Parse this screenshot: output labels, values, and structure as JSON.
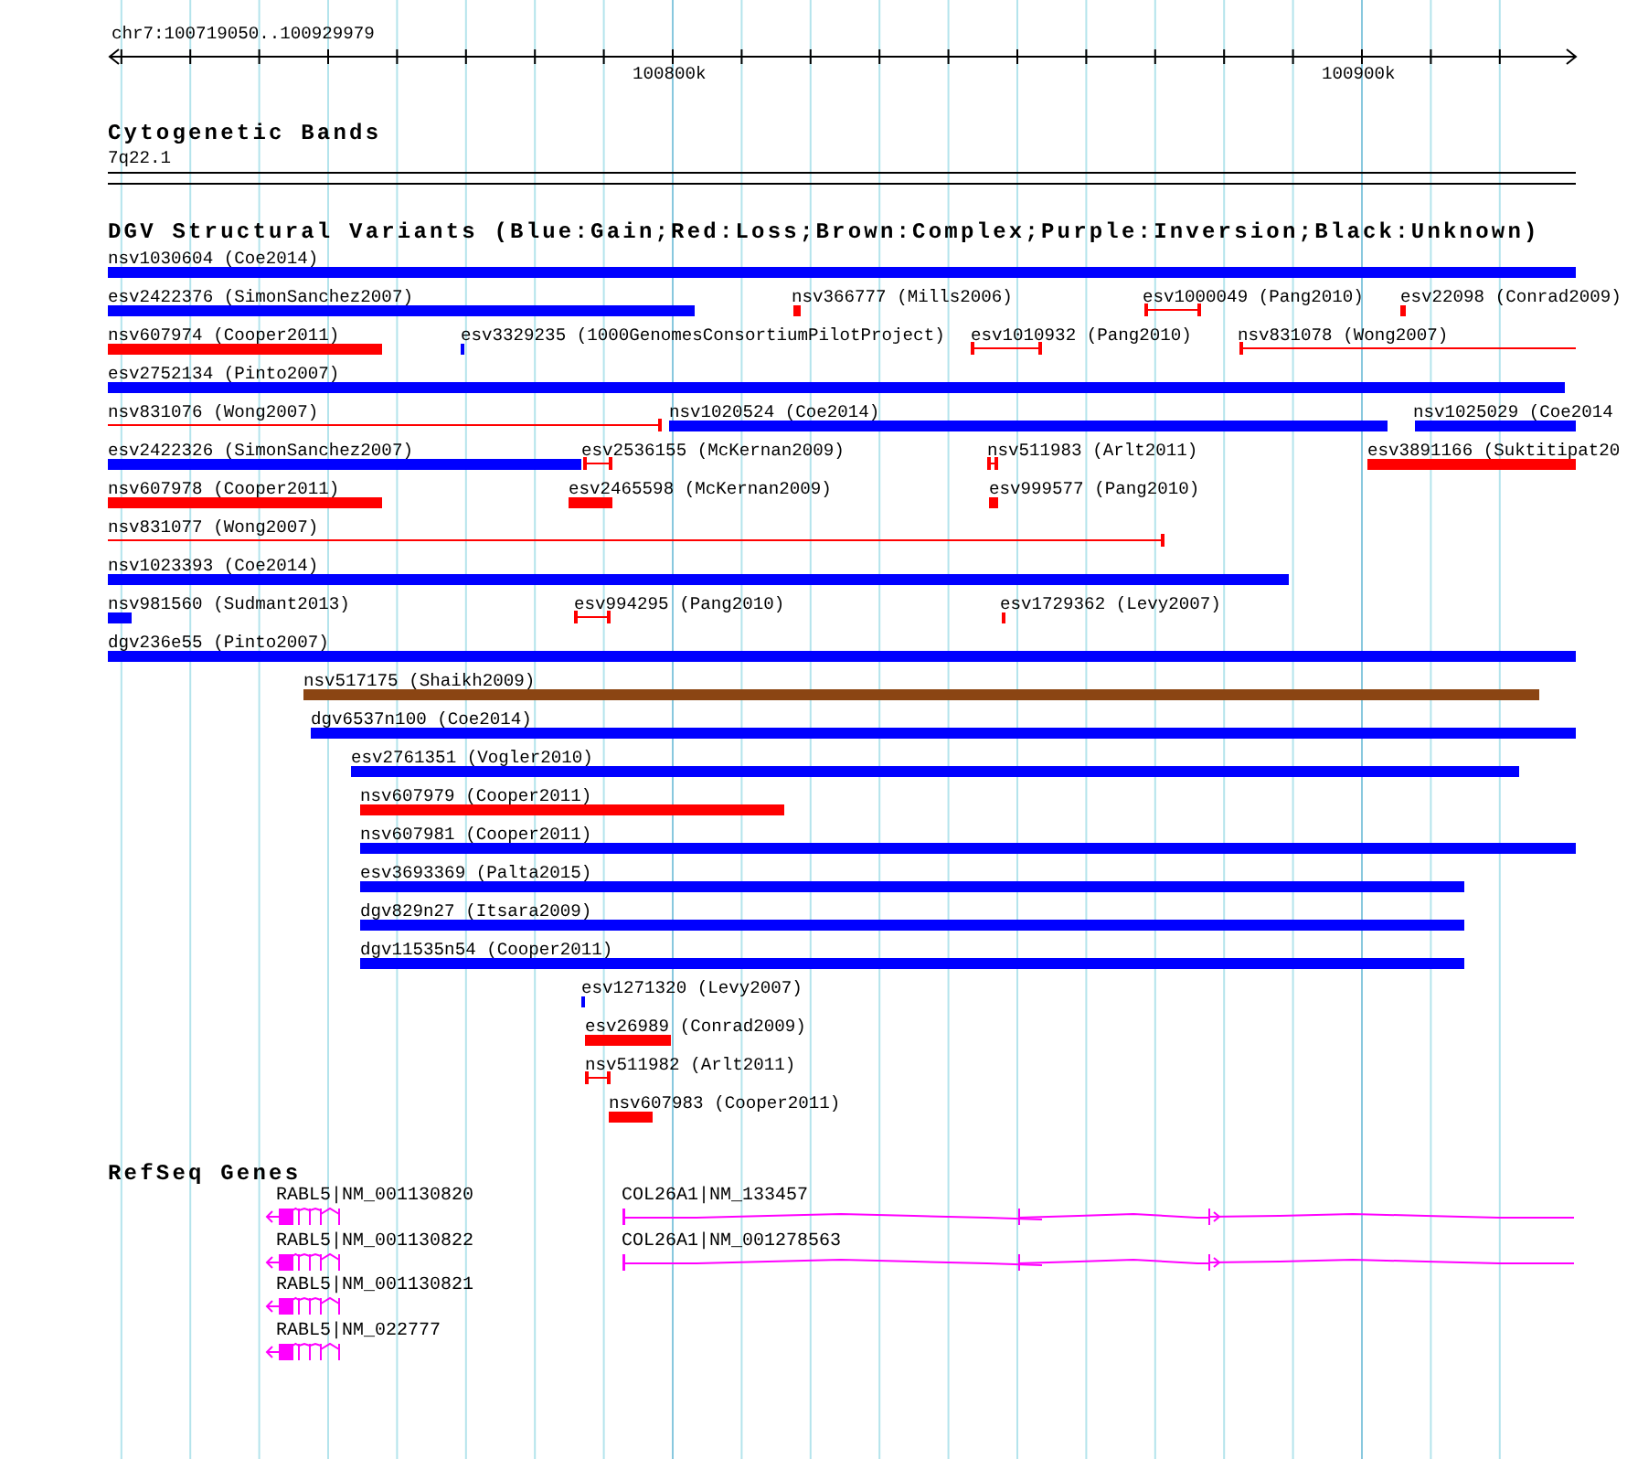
{
  "ruler": {
    "range": "chr7:100719050..100929979",
    "ticks": [
      {
        "label": "100800k"
      },
      {
        "label": "100900k"
      }
    ]
  },
  "cytogenetic_bands": {
    "title": "Cytogenetic Bands",
    "band": "7q22.1"
  },
  "variants": {
    "title": "DGV Structural Variants (Blue:Gain;Red:Loss;Brown:Complex;Purple:Inversion;Black:Unknown)",
    "features": [
      {
        "label": "nsv1030604 (Coe2014)",
        "kind": "bar",
        "color": "#0000ff"
      },
      {
        "label": "esv2422376 (SimonSanchez2007)",
        "kind": "bar",
        "color": "#0000ff"
      },
      {
        "label": "nsv366777 (Mills2006)",
        "kind": "bar",
        "color": "#ff0000"
      },
      {
        "label": "esv1000049 (Pang2010)",
        "kind": "span",
        "color": "#ff0000"
      },
      {
        "label": "esv22098 (Conrad2009)",
        "kind": "bar",
        "color": "#ff0000"
      },
      {
        "label": "nsv607974 (Cooper2011)",
        "kind": "bar",
        "color": "#ff0000"
      },
      {
        "label": "esv3329235 (1000GenomesConsortiumPilotProject)",
        "kind": "bar",
        "color": "#0000ff"
      },
      {
        "label": "esv1010932 (Pang2010)",
        "kind": "span",
        "color": "#ff0000"
      },
      {
        "label": "nsv831078 (Wong2007)",
        "kind": "span",
        "color": "#ff0000"
      },
      {
        "label": "esv2752134 (Pinto2007)",
        "kind": "bar",
        "color": "#0000ff"
      },
      {
        "label": "nsv831076 (Wong2007)",
        "kind": "span",
        "color": "#ff0000"
      },
      {
        "label": "nsv1020524 (Coe2014)",
        "kind": "bar",
        "color": "#0000ff"
      },
      {
        "label": "nsv1025029 (Coe2014",
        "kind": "bar",
        "color": "#0000ff"
      },
      {
        "label": "esv2422326 (SimonSanchez2007)",
        "kind": "bar",
        "color": "#0000ff"
      },
      {
        "label": "esv2536155 (McKernan2009)",
        "kind": "span",
        "color": "#ff0000"
      },
      {
        "label": "nsv511983 (Arlt2011)",
        "kind": "span",
        "color": "#ff0000"
      },
      {
        "label": "esv3891166 (Suktitipat20",
        "kind": "bar",
        "color": "#ff0000"
      },
      {
        "label": "nsv607978 (Cooper2011)",
        "kind": "bar",
        "color": "#ff0000"
      },
      {
        "label": "esv2465598 (McKernan2009)",
        "kind": "bar",
        "color": "#ff0000"
      },
      {
        "label": "esv999577 (Pang2010)",
        "kind": "bar",
        "color": "#ff0000"
      },
      {
        "label": "nsv831077 (Wong2007)",
        "kind": "span",
        "color": "#ff0000"
      },
      {
        "label": "nsv1023393 (Coe2014)",
        "kind": "bar",
        "color": "#0000ff"
      },
      {
        "label": "nsv981560 (Sudmant2013)",
        "kind": "bar",
        "color": "#0000ff"
      },
      {
        "label": "esv994295 (Pang2010)",
        "kind": "span",
        "color": "#ff0000"
      },
      {
        "label": "esv1729362 (Levy2007)",
        "kind": "bar",
        "color": "#ff0000"
      },
      {
        "label": "dgv236e55 (Pinto2007)",
        "kind": "bar",
        "color": "#0000ff"
      },
      {
        "label": "nsv517175 (Shaikh2009)",
        "kind": "bar",
        "color": "#8b4513"
      },
      {
        "label": "dgv6537n100 (Coe2014)",
        "kind": "bar",
        "color": "#0000ff"
      },
      {
        "label": "esv2761351 (Vogler2010)",
        "kind": "bar",
        "color": "#0000ff"
      },
      {
        "label": "nsv607979 (Cooper2011)",
        "kind": "bar",
        "color": "#ff0000"
      },
      {
        "label": "nsv607981 (Cooper2011)",
        "kind": "bar",
        "color": "#0000ff"
      },
      {
        "label": "esv3693369 (Palta2015)",
        "kind": "bar",
        "color": "#0000ff"
      },
      {
        "label": "dgv829n27 (Itsara2009)",
        "kind": "bar",
        "color": "#0000ff"
      },
      {
        "label": "dgv11535n54 (Cooper2011)",
        "kind": "bar",
        "color": "#0000ff"
      },
      {
        "label": "esv1271320 (Levy2007)",
        "kind": "bar",
        "color": "#0000ff"
      },
      {
        "label": "esv26989 (Conrad2009)",
        "kind": "bar",
        "color": "#ff0000"
      },
      {
        "label": "nsv511982 (Arlt2011)",
        "kind": "span",
        "color": "#ff0000"
      },
      {
        "label": "nsv607983 (Cooper2011)",
        "kind": "bar",
        "color": "#ff0000"
      }
    ]
  },
  "refseq_genes": {
    "title": "RefSeq Genes",
    "genes": [
      {
        "label": "RABL5|NM_001130820"
      },
      {
        "label": "RABL5|NM_001130822"
      },
      {
        "label": "RABL5|NM_001130821"
      },
      {
        "label": "RABL5|NM_022777"
      },
      {
        "label": "COL26A1|NM_133457"
      },
      {
        "label": "COL26A1|NM_001278563"
      }
    ]
  }
}
